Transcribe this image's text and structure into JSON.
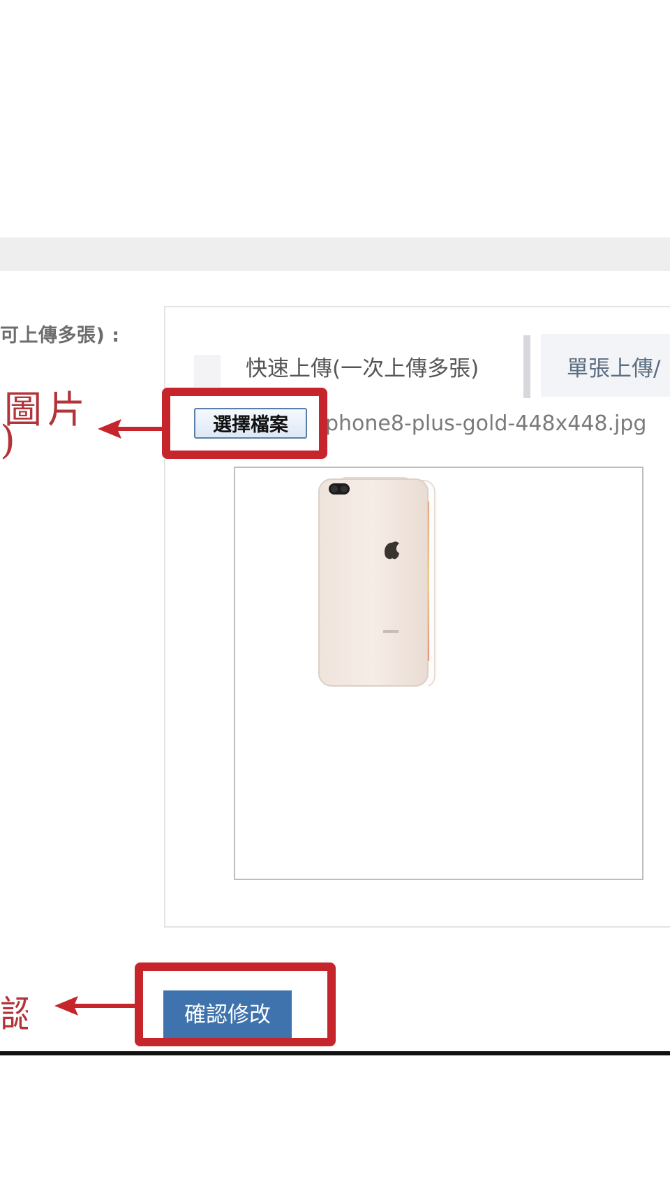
{
  "form": {
    "field_label": "可上傳多張) :",
    "tabs": [
      {
        "label": "快速上傳(一次上傳多張)"
      },
      {
        "label": "單張上傳/"
      }
    ],
    "file_input": {
      "button_label": "選擇檔案",
      "file_name": "phone8-plus-gold-448x448.jpg"
    },
    "submit_label": "確認修改"
  },
  "annotations": {
    "picture_note": "圖片",
    "picture_note_paren": ")",
    "confirm_note": "認",
    "highlight_color": "#c6252b"
  },
  "preview": {
    "image_subject": "gold smartphone, back and front view"
  },
  "colors": {
    "submit_bg": "#3f73ad",
    "tab_sep": "#d8d8dc",
    "header_strip": "#eeeeee"
  }
}
